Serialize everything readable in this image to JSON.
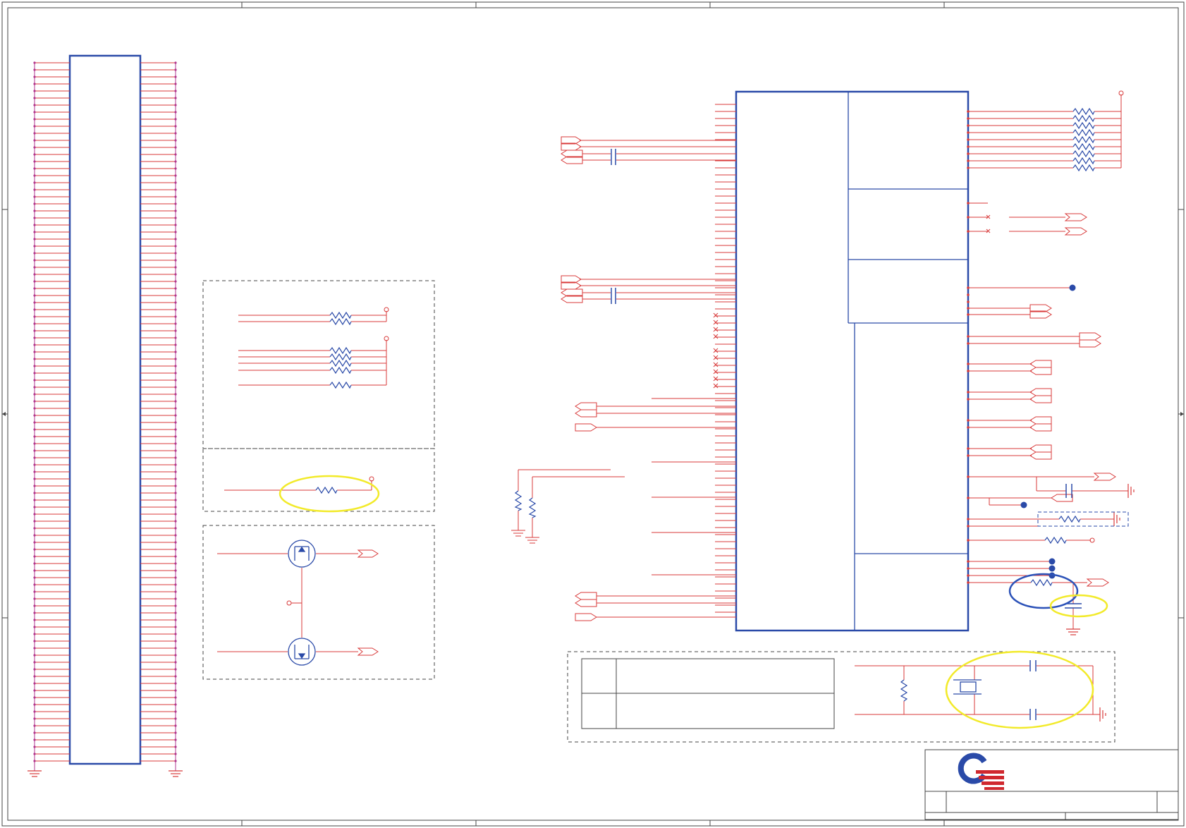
{
  "document": {
    "kind": "schematic-sheet",
    "visible_text": []
  },
  "colors": {
    "wire": "#d83a3a",
    "body": "#2a4aa8",
    "pin": "#b2378f",
    "frame": "#444444",
    "highlight_yellow": "#f2ea2a",
    "highlight_blue": "#2c52b8",
    "logo_blue": "#2a4aa8",
    "logo_red": "#d0282e"
  },
  "symbols": {
    "connector": "board-to-board-connector",
    "ic": "controller-ic",
    "pullup_group": "pullup-resistor-array",
    "level_shifter": "mosfet-level-shifter",
    "crystal": "crystal-oscillator-circuit",
    "logo": "company-logo",
    "title_block": "title-block"
  },
  "connector": {
    "pins_per_side": 100
  },
  "highlights": [
    {
      "id": "series-resistor",
      "color": "yellow"
    },
    {
      "id": "crystal-caps",
      "color": "yellow"
    },
    {
      "id": "bypass-cap",
      "color": "yellow"
    },
    {
      "id": "series-resistor-2",
      "color": "blue"
    }
  ]
}
